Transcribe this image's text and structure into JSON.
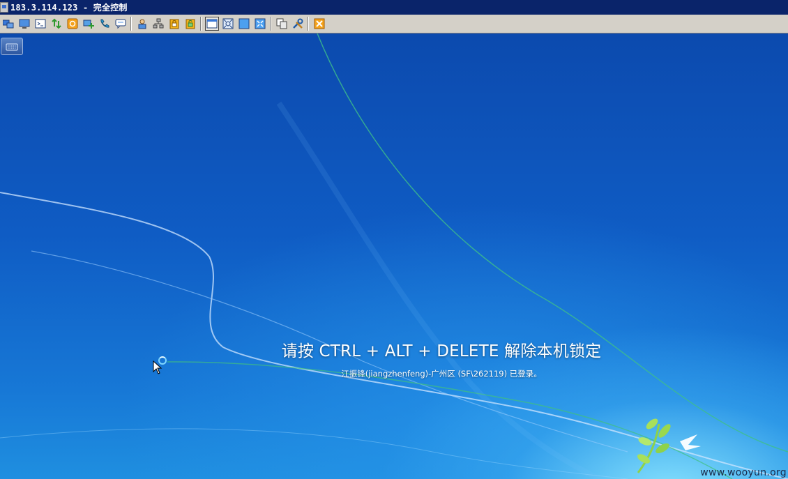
{
  "window": {
    "title": "183.3.114.123 - 完全控制"
  },
  "toolbar": {
    "buttons": [
      {
        "icon": "computers-icon"
      },
      {
        "icon": "screen-icon"
      },
      {
        "icon": "terminal-icon"
      },
      {
        "icon": "file-transfer-icon"
      },
      {
        "icon": "power-icon"
      },
      {
        "icon": "add-remote-icon"
      },
      {
        "icon": "phone-icon"
      },
      {
        "icon": "chat-icon"
      },
      {
        "icon": "user-upload-icon"
      },
      {
        "icon": "network-icon"
      },
      {
        "icon": "lock-icon"
      },
      {
        "icon": "unlock-icon"
      },
      {
        "icon": "window-mode-icon",
        "active": true
      },
      {
        "icon": "fit-screen-icon"
      },
      {
        "icon": "fullscreen-icon"
      },
      {
        "icon": "zoom-fit-icon"
      },
      {
        "icon": "copy-icon"
      },
      {
        "icon": "settings-tools-icon"
      },
      {
        "icon": "close-icon"
      }
    ]
  },
  "desktop": {
    "keyboard_button_icon": "keyboard-icon",
    "lock_message": "请按 CTRL + ALT + DELETE 解除本机锁定",
    "lock_subtext": "江振锋(jiangzhenfeng)-广州区 (SF\\262119) 已登录。"
  },
  "watermark": "www.wooyun.org",
  "colors": {
    "titlebar": "#0a246a",
    "toolbar": "#d4d0c8",
    "desktop_top": "#0c4aae",
    "desktop_glow": "#8ce6ff"
  }
}
